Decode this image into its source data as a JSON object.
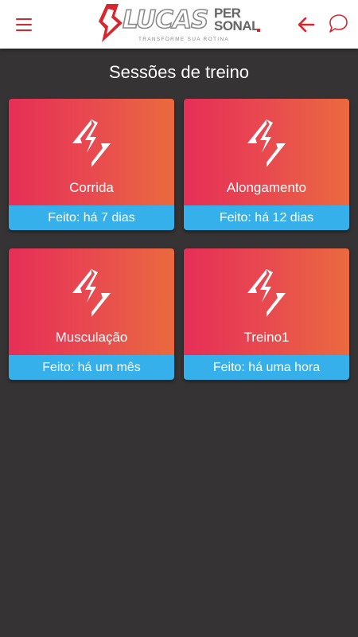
{
  "header": {
    "logo": {
      "name": "LUCAS",
      "per": "PER",
      "sonal": "SONAL",
      "tagline": "TRANSFORME SUA ROTINA"
    },
    "icons": {
      "menu": "menu-icon",
      "back": "arrow-left-icon",
      "chat": "chat-bubble-icon"
    },
    "accent_color": "#d8262f"
  },
  "main": {
    "title": "Sessões de treino",
    "cards": [
      {
        "title": "Corrida",
        "status": "Feito: há 7 dias"
      },
      {
        "title": "Alongamento",
        "status": "Feito: há 12 dias"
      },
      {
        "title": "Musculação",
        "status": "Feito: há um mês"
      },
      {
        "title": "Treino1",
        "status": "Feito: há uma hora"
      }
    ]
  },
  "colors": {
    "background": "#363334",
    "card_gradient_start": "#e62e57",
    "card_gradient_end": "#ea6a3f",
    "status_bar": "#36b0ea"
  }
}
